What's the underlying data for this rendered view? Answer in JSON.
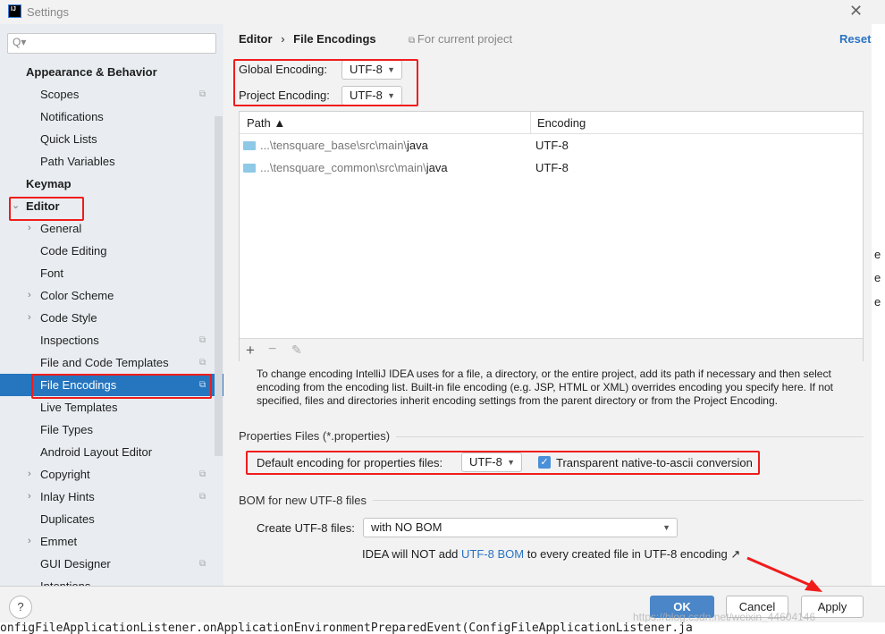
{
  "window": {
    "title": "Settings",
    "close_icon": "close-icon"
  },
  "sidebar": {
    "search_placeholder": "Q▾",
    "items": [
      {
        "label": "Appearance & Behavior",
        "level": 0,
        "bold": true
      },
      {
        "label": "Scopes",
        "level": 1,
        "copy": true
      },
      {
        "label": "Notifications",
        "level": 1
      },
      {
        "label": "Quick Lists",
        "level": 1
      },
      {
        "label": "Path Variables",
        "level": 1
      },
      {
        "label": "Keymap",
        "level": 0,
        "bold": true
      },
      {
        "label": "Editor",
        "level": 0,
        "bold": true,
        "expanded": true
      },
      {
        "label": "General",
        "level": 1,
        "chevron": true
      },
      {
        "label": "Code Editing",
        "level": 1
      },
      {
        "label": "Font",
        "level": 1
      },
      {
        "label": "Color Scheme",
        "level": 1,
        "chevron": true
      },
      {
        "label": "Code Style",
        "level": 1,
        "chevron": true
      },
      {
        "label": "Inspections",
        "level": 1,
        "copy": true
      },
      {
        "label": "File and Code Templates",
        "level": 1,
        "copy": true
      },
      {
        "label": "File Encodings",
        "level": 1,
        "copy": true,
        "selected": true
      },
      {
        "label": "Live Templates",
        "level": 1
      },
      {
        "label": "File Types",
        "level": 1
      },
      {
        "label": "Android Layout Editor",
        "level": 1
      },
      {
        "label": "Copyright",
        "level": 1,
        "chevron": true,
        "copy": true
      },
      {
        "label": "Inlay Hints",
        "level": 1,
        "chevron": true,
        "copy": true
      },
      {
        "label": "Duplicates",
        "level": 1
      },
      {
        "label": "Emmet",
        "level": 1,
        "chevron": true
      },
      {
        "label": "GUI Designer",
        "level": 1,
        "copy": true
      },
      {
        "label": "Intentions",
        "level": 1
      }
    ]
  },
  "main": {
    "breadcrumb": {
      "parent": "Editor",
      "sep": "›",
      "current": "File Encodings"
    },
    "for_current_project": "For current project",
    "reset": "Reset",
    "global_encoding": {
      "label": "Global Encoding:",
      "value": "UTF-8"
    },
    "project_encoding": {
      "label": "Project Encoding:",
      "value": "UTF-8"
    },
    "table": {
      "columns": [
        "Path ▲",
        "Encoding"
      ],
      "rows": [
        {
          "path_prefix": "...\\tensquare_base\\src\\main\\",
          "path_leaf": "java",
          "encoding": "UTF-8"
        },
        {
          "path_prefix": "...\\tensquare_common\\src\\main\\",
          "path_leaf": "java",
          "encoding": "UTF-8"
        }
      ],
      "tools": {
        "add": "+",
        "remove": "−",
        "edit": "✎"
      }
    },
    "description": "To change encoding IntelliJ IDEA uses for a file, a directory, or the entire project, add its path if necessary and then select encoding from the encoding list. Built-in file encoding (e.g. JSP, HTML or XML) overrides encoding you specify here. If not specified, files and directories inherit encoding settings from the parent directory or from the Project Encoding.",
    "properties": {
      "section": "Properties Files (*.properties)",
      "label": "Default encoding for properties files:",
      "value": "UTF-8",
      "checkbox_label": "Transparent native-to-ascii conversion",
      "checked": true
    },
    "bom": {
      "section": "BOM for new UTF-8 files",
      "label": "Create UTF-8 files:",
      "value": "with NO BOM",
      "note_a": "IDEA will NOT add ",
      "note_link": "UTF-8 BOM",
      "note_b": " to every created file in UTF-8 encoding ↗"
    }
  },
  "footer": {
    "help": "?",
    "ok": "OK",
    "cancel": "Cancel",
    "apply": "Apply"
  },
  "background": {
    "code": "onfigFileApplicationListener.onApplicationEnvironmentPreparedEvent(ConfigFileApplicationListener.ja",
    "edge_letters": [
      "e",
      "e",
      "e"
    ],
    "watermark": "https://blog.csdn.net/weixin_44604146"
  },
  "colors": {
    "accent": "#2675bf",
    "highlight": "#f01c1c",
    "link": "#2a73c4"
  }
}
